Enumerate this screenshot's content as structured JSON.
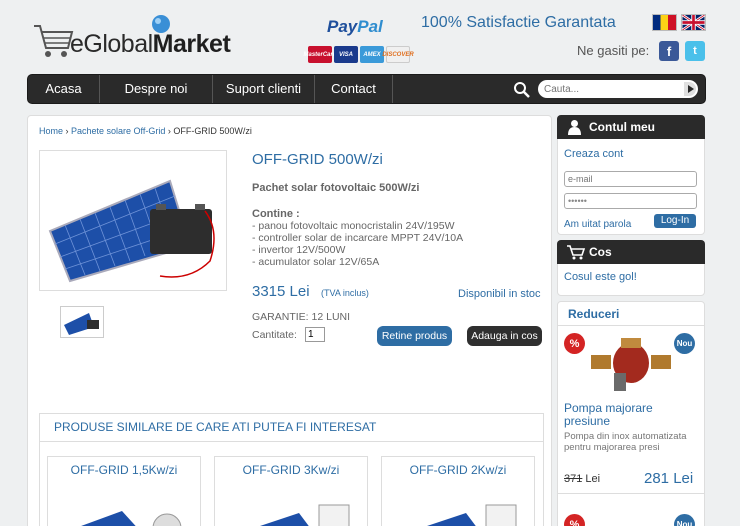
{
  "header": {
    "logo_light": "eGlobal",
    "logo_bold": "Market",
    "paypal_a": "Pay",
    "paypal_b": "Pal",
    "satisfaction": "100% Satisfactie Garantata",
    "find_us": "Ne gasiti pe:",
    "cards": [
      "MasterCard",
      "VISA",
      "AMEX",
      "DISCOVER"
    ]
  },
  "nav": {
    "items": [
      "Acasa",
      "Despre noi",
      "Suport clienti",
      "Contact"
    ],
    "search_placeholder": "Cauta..."
  },
  "breadcrumb": {
    "home": "Home",
    "sep1": " › ",
    "category": "Pachete solare Off-Grid",
    "sep2": " › ",
    "current": "OFF-GRID 500W/zi"
  },
  "product": {
    "title": "OFF-GRID 500W/zi",
    "subtitle": "Pachet solar fotovoltaic 500W/zi",
    "contains_label": "Contine :",
    "specs": [
      "- panou fotovoltaic monocristalin 24V/195W",
      "- controller solar de incarcare MPPT 24V/10A",
      "- invertor 12V/500W",
      "- acumulator solar 12V/65A"
    ],
    "price": "3315 Lei",
    "vat": "(TVA inclus)",
    "availability": "Disponibil in stoc",
    "warranty": "GARANTIE: 12 LUNI",
    "quantity_label": "Cantitate:",
    "quantity_value": "1",
    "save_button": "Retine produs",
    "add_button": "Adauga in cos"
  },
  "similar": {
    "title": "PRODUSE SIMILARE DE CARE ATI PUTEA FI INTERESAT",
    "items": [
      "OFF-GRID 1,5Kw/zi",
      "OFF-GRID 3Kw/zi",
      "OFF-GRID 2Kw/zi"
    ]
  },
  "sidebar": {
    "account_title": "Contul meu",
    "create_account": "Creaza cont",
    "email_placeholder": "e-mail",
    "password_value": "••••••",
    "forgot_password": "Am uitat parola",
    "login_button": "Log-In",
    "cart_title": "Cos",
    "cart_empty": "Cosul este gol!",
    "discounts_title": "Reduceri",
    "badge_discount": "%",
    "badge_new": "Nou",
    "promo": {
      "title": "Pompa majorare presiune",
      "description": "Pompa din inox automatizata pentru majorarea presi",
      "old_price": "371",
      "old_currency": " Lei",
      "new_price": "281 Lei"
    }
  },
  "colors": {
    "accent": "#2e6da4",
    "dark": "#2a2a2a",
    "discount_badge": "#d42424",
    "new_badge": "#2e6da4"
  }
}
